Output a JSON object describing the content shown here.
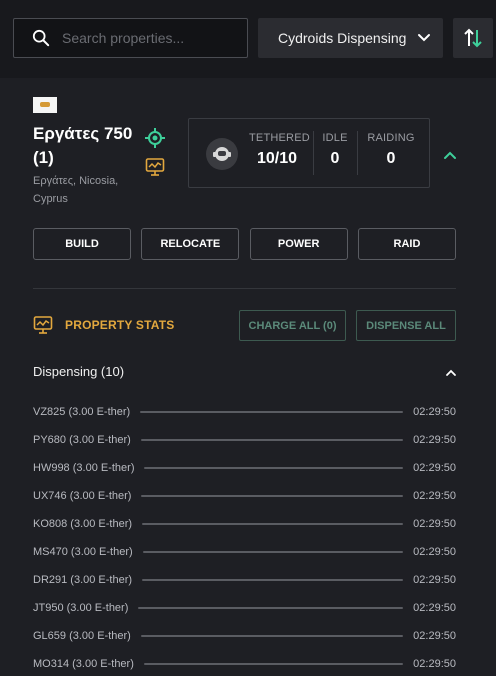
{
  "search": {
    "placeholder": "Search properties...",
    "value": ""
  },
  "filter": {
    "selected": "Cydroids Dispensing"
  },
  "colors": {
    "accent_green": "#3ecf9a",
    "accent_orange": "#e3a83e",
    "background": "#1e1f24"
  },
  "property": {
    "title": "Εργάτες 750 (1)",
    "location": "Εργάτες, Nicosia, Cyprus",
    "flag": "cyprus-flag"
  },
  "stats": {
    "tethered_label": "TETHERED",
    "tethered_value": "10/10",
    "idle_label": "IDLE",
    "idle_value": "0",
    "raiding_label": "RAIDING",
    "raiding_value": "0"
  },
  "actions": [
    "BUILD",
    "RELOCATE",
    "POWER",
    "RAID"
  ],
  "property_stats": {
    "title": "PROPERTY STATS",
    "charge_all": "CHARGE ALL (0)",
    "dispense_all": "DISPENSE ALL"
  },
  "dispensing": {
    "header": "Dispensing (10)",
    "items": [
      {
        "name": "VZ825 (3.00 E-ther)",
        "time": "02:29:50"
      },
      {
        "name": "PY680 (3.00 E-ther)",
        "time": "02:29:50"
      },
      {
        "name": "HW998 (3.00 E-ther)",
        "time": "02:29:50"
      },
      {
        "name": "UX746 (3.00 E-ther)",
        "time": "02:29:50"
      },
      {
        "name": "KO808 (3.00 E-ther)",
        "time": "02:29:50"
      },
      {
        "name": "MS470 (3.00 E-ther)",
        "time": "02:29:50"
      },
      {
        "name": "DR291 (3.00 E-ther)",
        "time": "02:29:50"
      },
      {
        "name": "JT950 (3.00 E-ther)",
        "time": "02:29:50"
      },
      {
        "name": "GL659 (3.00 E-ther)",
        "time": "02:29:50"
      },
      {
        "name": "MO314 (3.00 E-ther)",
        "time": "02:29:50"
      }
    ]
  }
}
